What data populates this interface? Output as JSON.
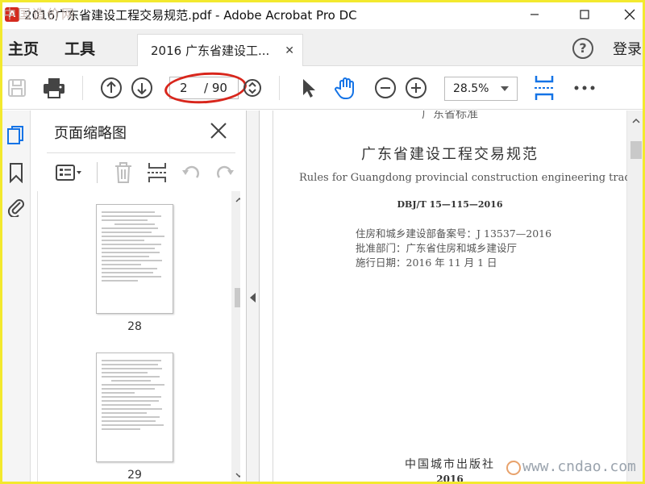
{
  "window": {
    "title": "2016广东省建设工程交易规范.pdf - Adobe Acrobat Pro DC",
    "watermark_top": "中国造价网"
  },
  "tabs": {
    "home": "主页",
    "tools": "工具",
    "document_tab": "2016 广东省建设工...",
    "help": "?",
    "login": "登录"
  },
  "toolbar": {
    "page_current": "2",
    "page_total": "/ 90",
    "zoom": "28.5%"
  },
  "thumbnails_panel": {
    "title": "页面缩略图",
    "pages": [
      {
        "label": "28"
      },
      {
        "label": "29"
      }
    ]
  },
  "document": {
    "top_cut_text": "广东省标准",
    "title_cn": "广东省建设工程交易规范",
    "title_en": "Rules for Guangdong provincial construction engineering trading",
    "code": "DBJ/T 15—115—2016",
    "record_no": "住房和城乡建设部备案号：J 13537—2016",
    "approval_dept": "批准部门：广东省住房和城乡建设厅",
    "effective_date": "施行日期：2016 年 11 月 1 日",
    "publisher": "中国城市出版社",
    "year": "2016"
  },
  "watermark_bottom": "www.cndao.com",
  "colors": {
    "accent_blue": "#1473e6",
    "highlight_red": "#d8261c",
    "frame_yellow": "#f3e92e"
  }
}
